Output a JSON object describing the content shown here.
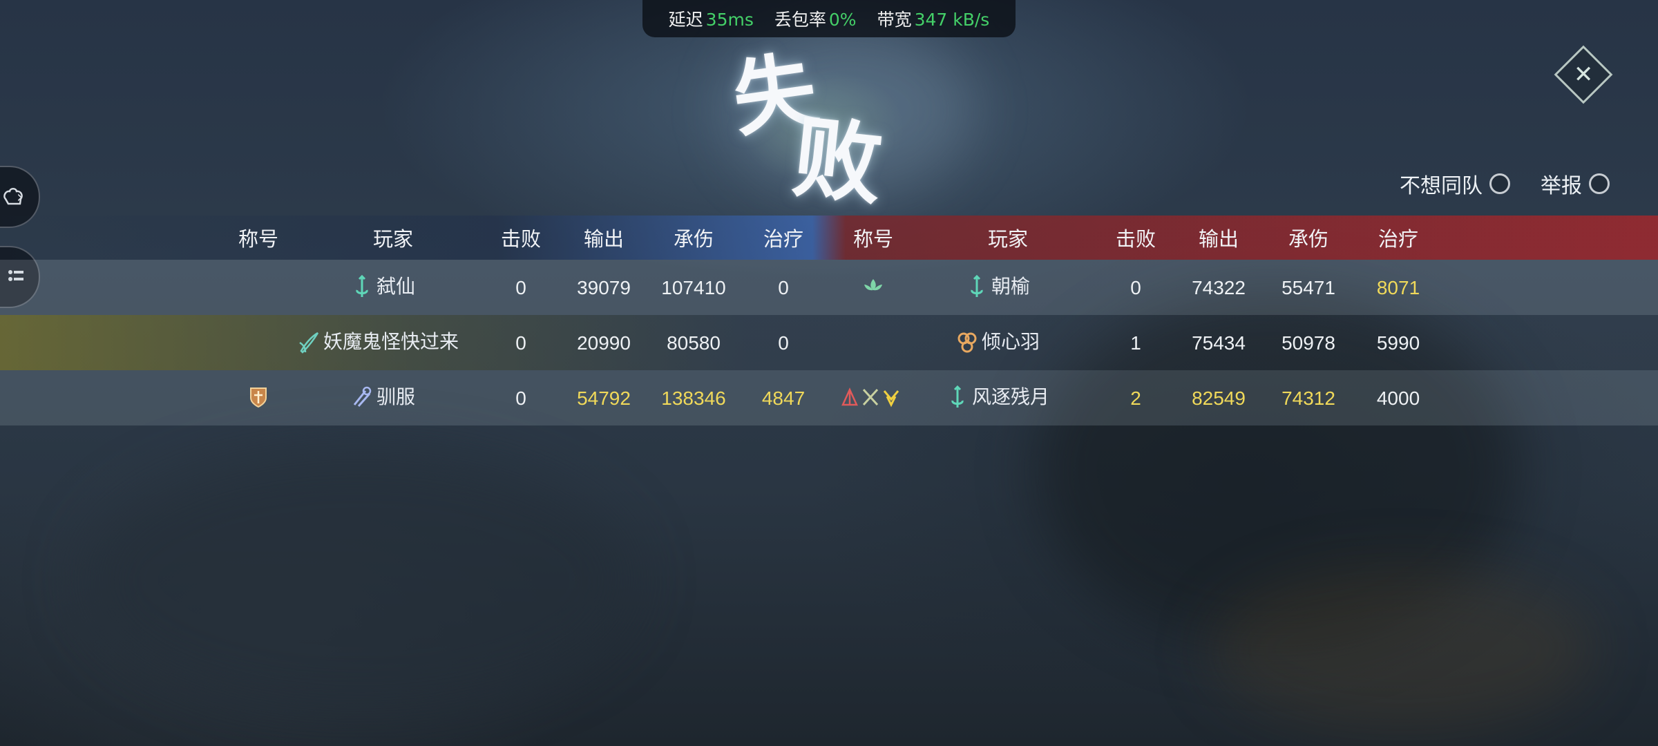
{
  "network": {
    "latency_label": "延迟",
    "latency_value": "35ms",
    "loss_label": "丢包率",
    "loss_value": "0%",
    "bandwidth_label": "带宽",
    "bandwidth_value": "347 kB/s"
  },
  "title": {
    "char1": "失",
    "char2": "败"
  },
  "options": {
    "no_team_label": "不想同队",
    "report_label": "举报"
  },
  "headers": {
    "left": [
      "称号",
      "玩家",
      "击败",
      "输出",
      "承伤",
      "治疗"
    ],
    "right": [
      "称号",
      "玩家",
      "击败",
      "输出",
      "承伤",
      "治疗"
    ]
  },
  "left_team": [
    {
      "player": "弑仙",
      "kills": "0",
      "damage": "39079",
      "taken": "107410",
      "heal": "0",
      "icon": "spear-icon",
      "title_icon": ""
    },
    {
      "player": "妖魔鬼怪快过来",
      "kills": "0",
      "damage": "20990",
      "taken": "80580",
      "heal": "0",
      "icon": "blade-icon",
      "title_icon": ""
    },
    {
      "player": "驯服",
      "kills": "0",
      "damage": "54792",
      "taken": "138346",
      "heal": "4847",
      "icon": "beast-icon",
      "title_icon": "shield-badge-icon"
    }
  ],
  "right_team": [
    {
      "player": "朝榆",
      "kills": "0",
      "damage": "74322",
      "taken": "55471",
      "heal": "8071",
      "icon": "spear-icon",
      "title_icon": "lotus-icon"
    },
    {
      "player": "倾心羽",
      "kills": "1",
      "damage": "75434",
      "taken": "50978",
      "heal": "5990",
      "icon": "mask-icon",
      "title_icon": ""
    },
    {
      "player": "风逐残月",
      "kills": "2",
      "damage": "82549",
      "taken": "74312",
      "heal": "4000",
      "icon": "spear-icon",
      "title_icon": "triple-badge-icon"
    }
  ],
  "highlight_color": "#f0d95a",
  "good_color": "#44d068"
}
